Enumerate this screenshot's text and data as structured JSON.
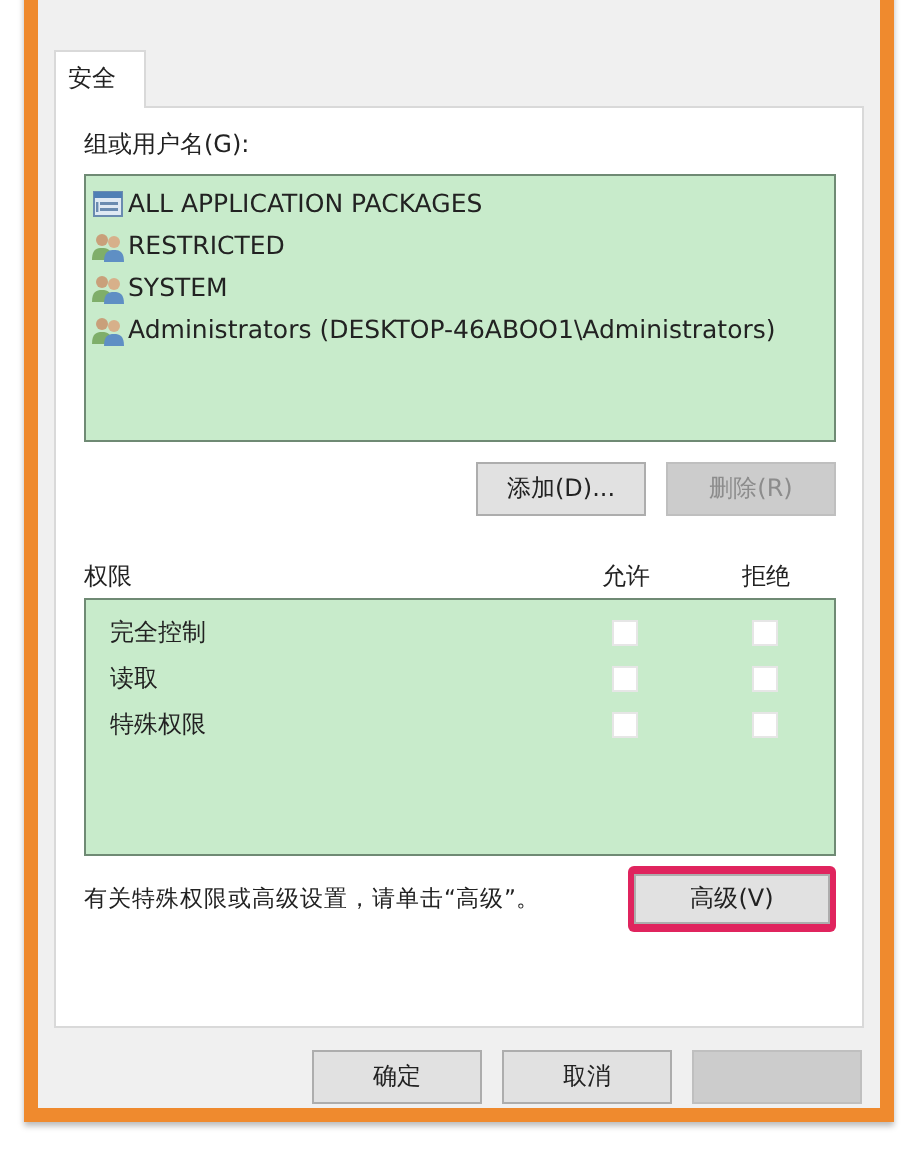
{
  "tabs": [
    {
      "label": "安全",
      "selected": true
    }
  ],
  "groups": {
    "label": "组或用户名(G):",
    "items": [
      {
        "name": "ALL APPLICATION PACKAGES",
        "kind": "package"
      },
      {
        "name": "RESTRICTED",
        "kind": "users"
      },
      {
        "name": "SYSTEM",
        "kind": "users"
      },
      {
        "name": "Administrators (DESKTOP-46ABOO1\\Administrators)",
        "kind": "users"
      }
    ]
  },
  "group_buttons": [
    {
      "label": "添加(D)...",
      "disabled": false
    },
    {
      "label": "删除(R)",
      "disabled": true
    }
  ],
  "permissions": {
    "label": "权限",
    "allow_header": "允许",
    "deny_header": "拒绝",
    "rows": [
      {
        "name": "完全控制",
        "allow": false,
        "deny": false
      },
      {
        "name": "读取",
        "allow": false,
        "deny": false
      },
      {
        "name": "特殊权限",
        "allow": false,
        "deny": false
      }
    ]
  },
  "advanced": {
    "hint": "有关特殊权限或高级设置，请单击“高级”。",
    "button": "高级(V)",
    "highlighted": true
  },
  "dialog_buttons": [
    {
      "label": "确定",
      "disabled": false
    },
    {
      "label": "取消",
      "disabled": false
    },
    {
      "disabled": true
    }
  ]
}
